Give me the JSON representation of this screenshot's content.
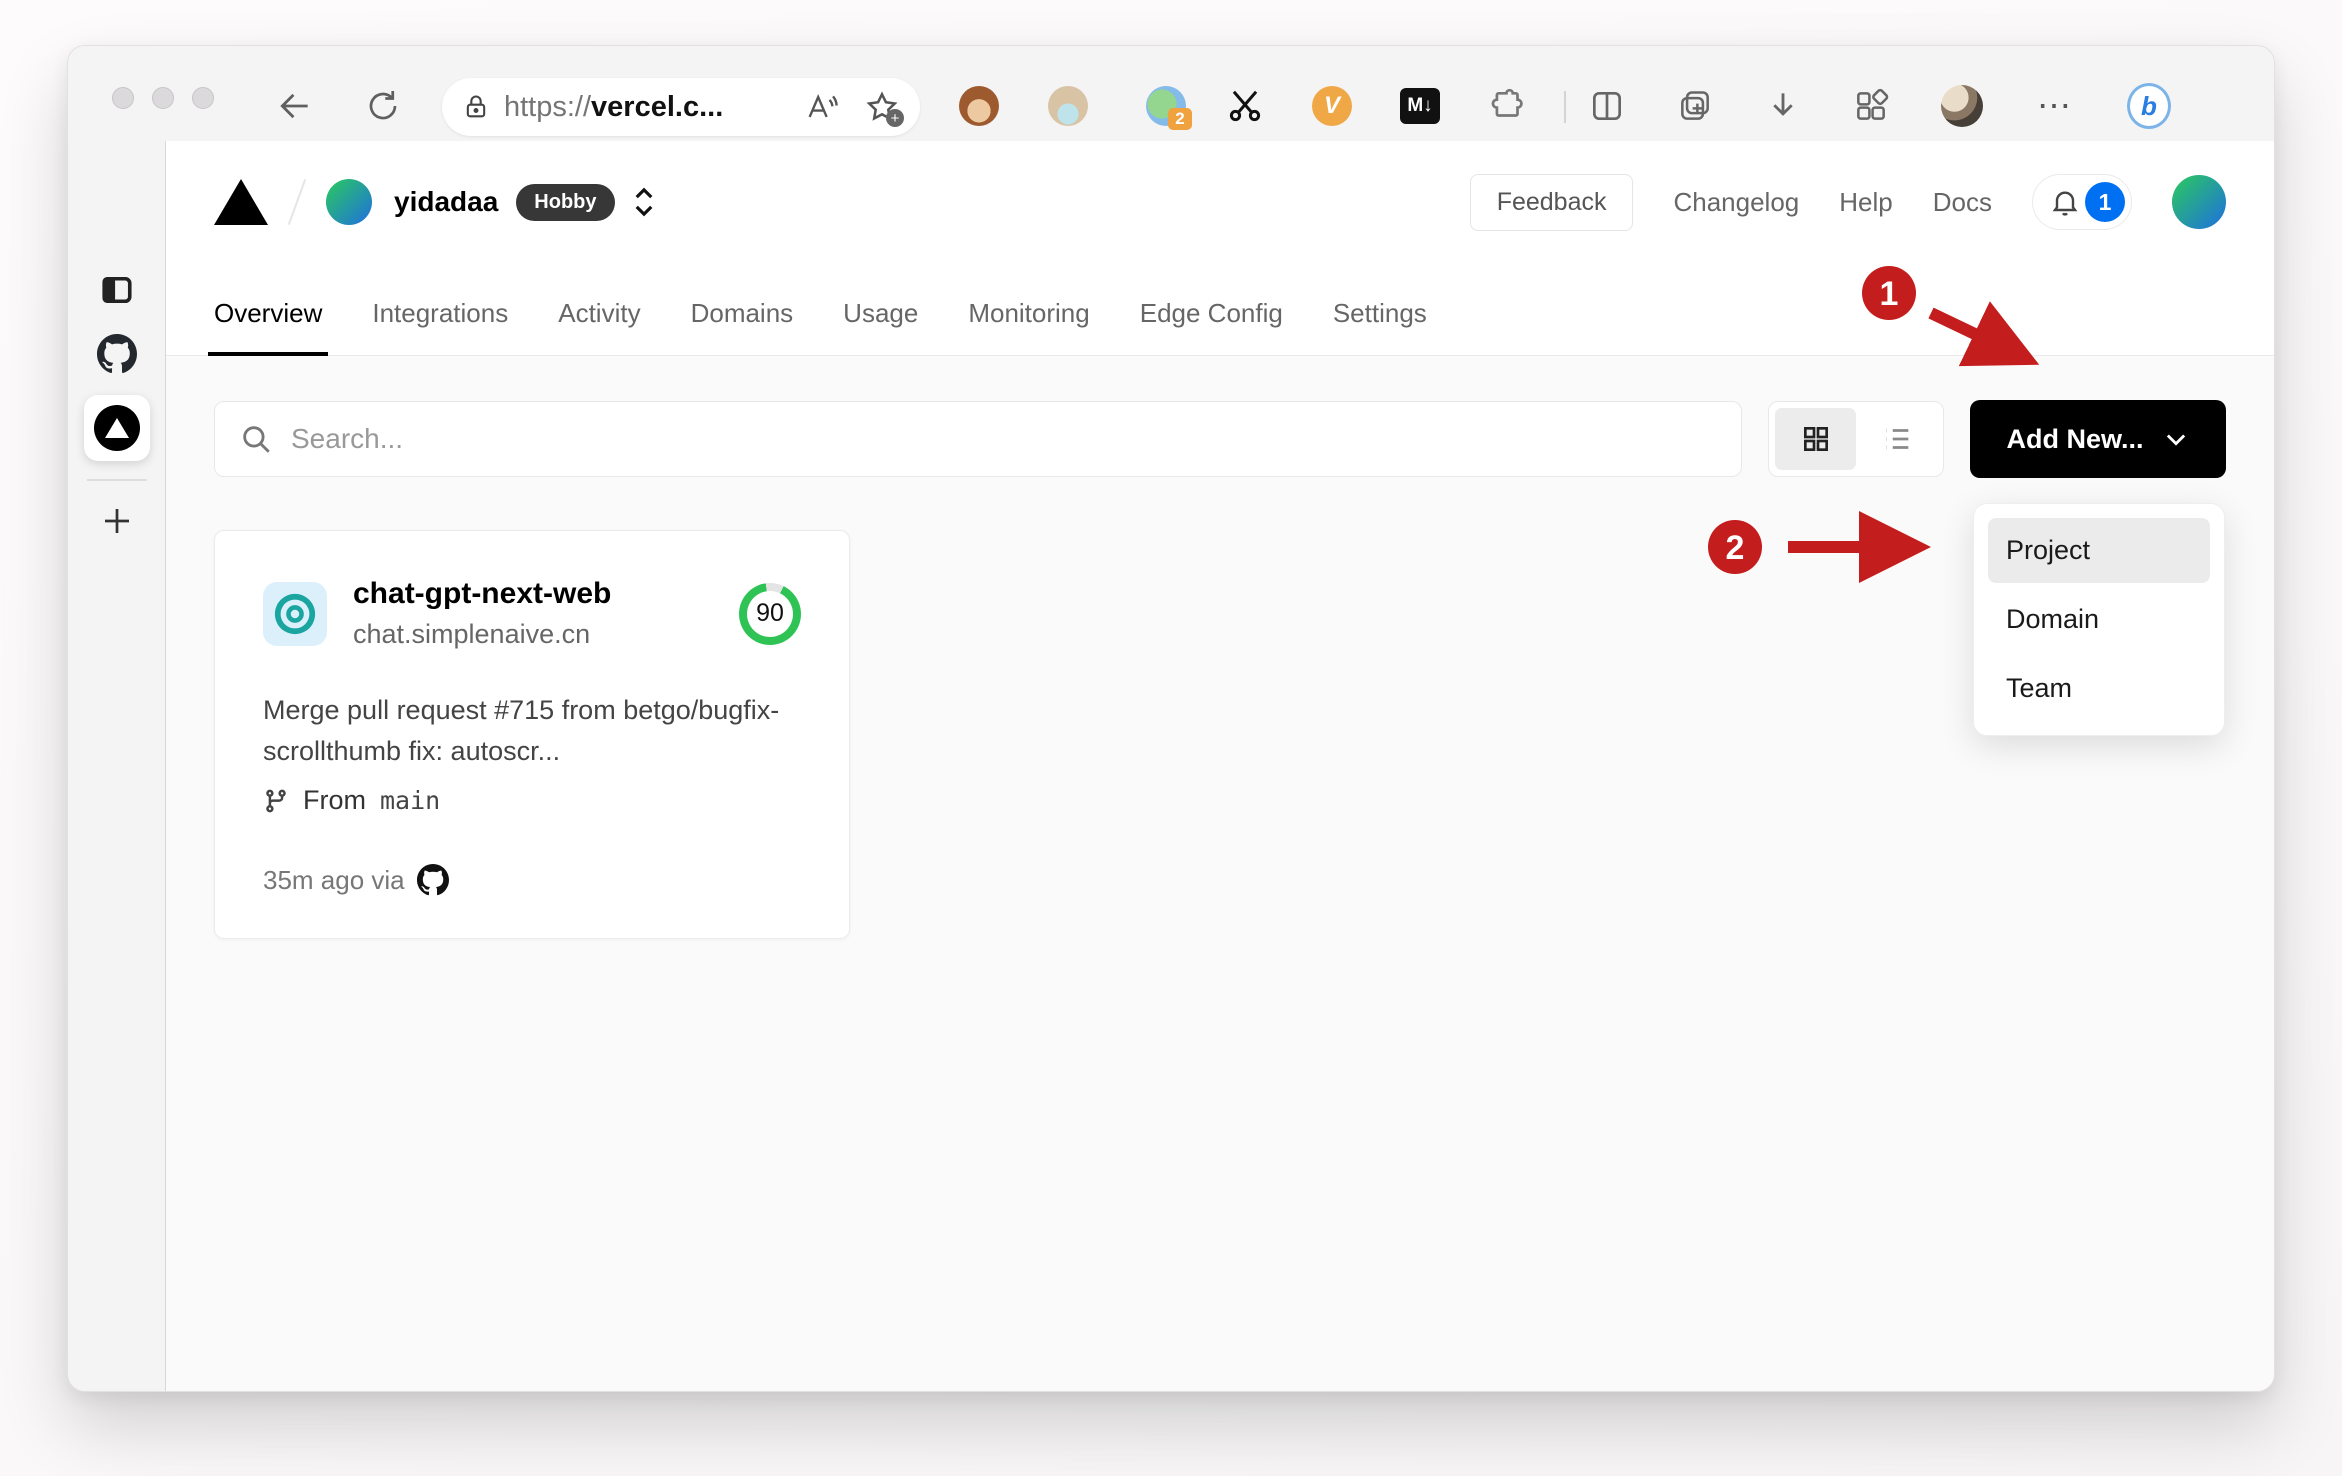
{
  "browser": {
    "url_scheme": "https://",
    "url_host": "vercel.c...",
    "extension_badge_count": "2",
    "markdown_ext_label": "M↓",
    "bing_label": "b",
    "vpn_ext_label": "V"
  },
  "sidebar": {
    "active_tab": "vercel-dashboard"
  },
  "header": {
    "team_name": "yidadaa",
    "plan_badge": "Hobby",
    "feedback_label": "Feedback",
    "links": [
      {
        "label": "Changelog"
      },
      {
        "label": "Help"
      },
      {
        "label": "Docs"
      }
    ],
    "notification_count": "1"
  },
  "tabs": [
    {
      "label": "Overview",
      "active": true
    },
    {
      "label": "Integrations",
      "active": false
    },
    {
      "label": "Activity",
      "active": false
    },
    {
      "label": "Domains",
      "active": false
    },
    {
      "label": "Usage",
      "active": false
    },
    {
      "label": "Monitoring",
      "active": false
    },
    {
      "label": "Edge Config",
      "active": false
    },
    {
      "label": "Settings",
      "active": false
    }
  ],
  "toolbar": {
    "search_placeholder": "Search...",
    "add_new_label": "Add New..."
  },
  "dropdown": {
    "items": [
      {
        "label": "Project",
        "highlighted": true
      },
      {
        "label": "Domain",
        "highlighted": false
      },
      {
        "label": "Team",
        "highlighted": false
      }
    ]
  },
  "project_card": {
    "name": "chat-gpt-next-web",
    "domain": "chat.simplenaive.cn",
    "score": "90",
    "commit_message": "Merge pull request #715 from betgo/bugfix-scrollthumb fix: autoscr...",
    "branch_prefix": "From",
    "branch_name": "main",
    "deploy_time": "35m ago via"
  },
  "annotations": {
    "step1": "1",
    "step2": "2",
    "color": "#c41d1d"
  },
  "colors": {
    "accent_blue": "#0070f3",
    "score_green": "#2fc356",
    "badge_dark": "#373737",
    "annotation_red": "#c41d1d"
  }
}
